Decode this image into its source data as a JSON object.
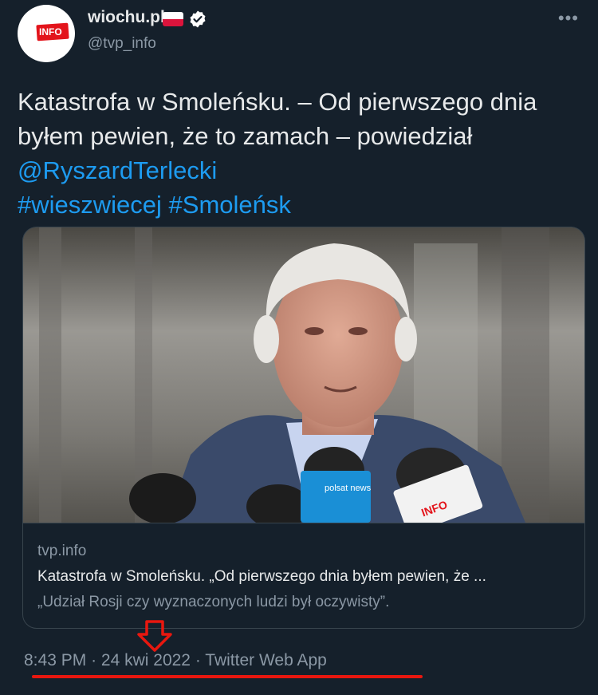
{
  "header": {
    "display_name": "wiochu.pl",
    "handle": "@tvp_info",
    "avatar_logo_text": "INFO",
    "more_icon": "more-dots-icon"
  },
  "tweet": {
    "text_plain": "Katastrofa w Smoleńsku. – Od pierwszego dnia byłem pewien, że to zamach – powiedział ",
    "mention": "@RyszardTerlecki",
    "hashtags": [
      "#wieszwiecej",
      "#Smoleńsk"
    ]
  },
  "card": {
    "domain": "tvp.info",
    "title": "Katastrofa w Smoleńsku. „Od pierwszego dnia byłem pewien, że ...",
    "description": "„Udział Rosji czy wyznaczonych ludzi był oczywisty”.",
    "image_mic_labels": [
      "polsat news",
      "INFO"
    ]
  },
  "footer": {
    "time": "8:43 PM",
    "date": "24 kwi 2022",
    "source": "Twitter Web App",
    "separator": "·"
  },
  "colors": {
    "background": "#15202b",
    "link": "#1d9bf0",
    "secondary_text": "#8b98a5",
    "annotation_red": "#e8170f"
  }
}
